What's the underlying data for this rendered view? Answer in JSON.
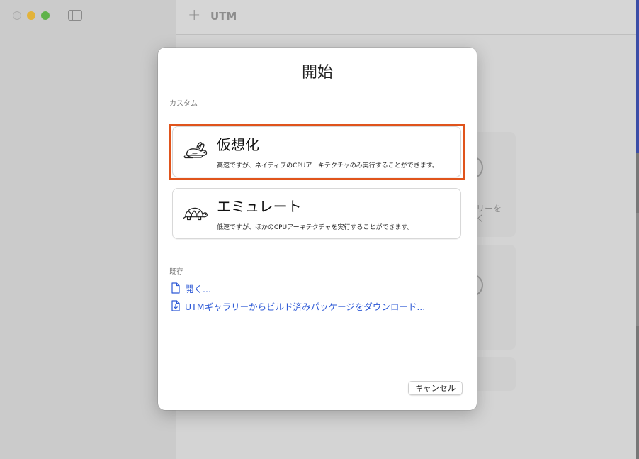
{
  "window": {
    "app_title": "UTM",
    "add_icon": "plus-icon",
    "background_text": [
      "リーを",
      "く"
    ]
  },
  "dialog": {
    "title": "開始",
    "custom_section_label": "カスタム",
    "options": [
      {
        "title": "仮想化",
        "description": "高速ですが、ネイティブのCPUアーキテクチャのみ実行することができます。",
        "icon": "rabbit-icon",
        "highlighted": true
      },
      {
        "title": "エミュレート",
        "description": "低速ですが、ほかのCPUアーキテクチャを実行することができます。",
        "icon": "turtle-icon",
        "highlighted": false
      }
    ],
    "existing_section_label": "既存",
    "links": [
      {
        "label": "開く...",
        "icon": "document-icon"
      },
      {
        "label": "UTMギャラリーからビルド済みパッケージをダウンロード...",
        "icon": "download-document-icon"
      }
    ],
    "cancel_label": "キャンセル"
  },
  "colors": {
    "highlight": "#e0541c",
    "link": "#2d59d6"
  }
}
